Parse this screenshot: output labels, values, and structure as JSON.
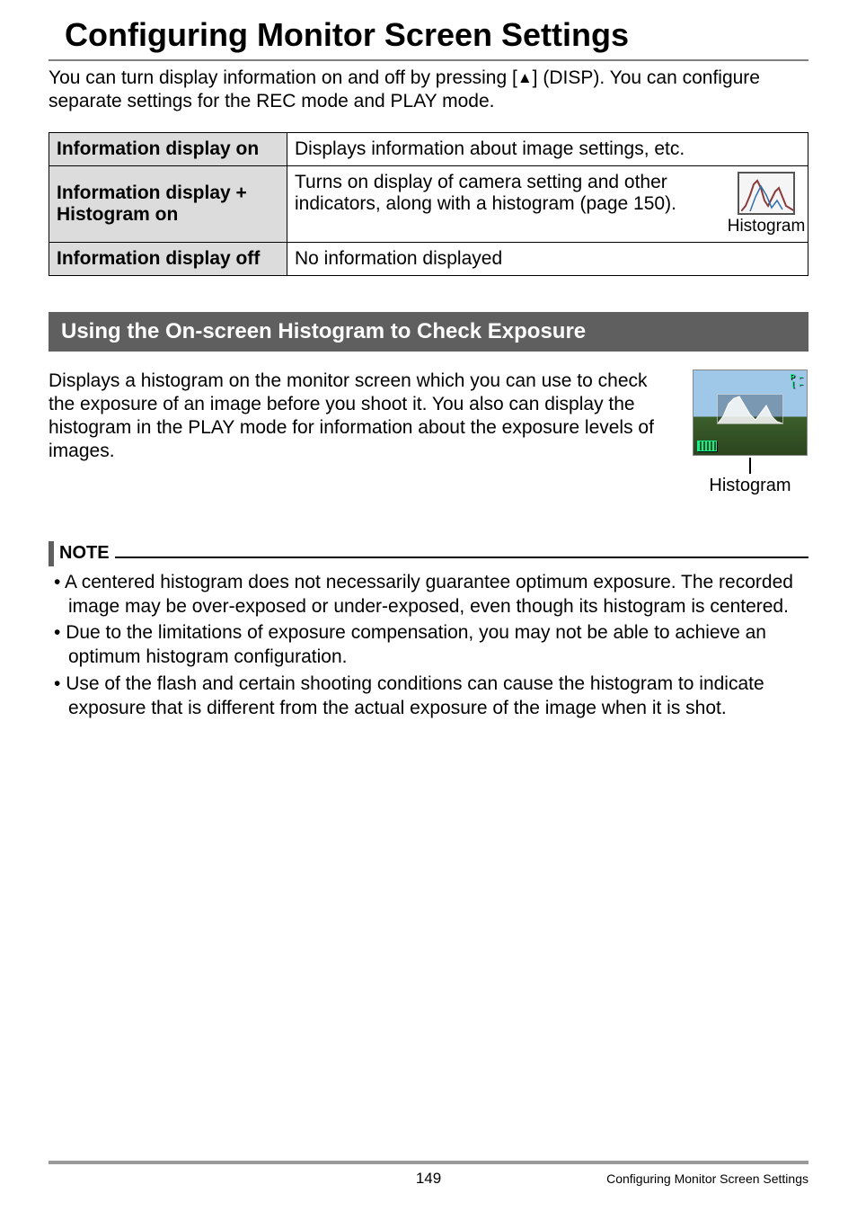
{
  "title": "Configuring Monitor Screen Settings",
  "intro_parts": {
    "before": "You can turn display information on and off by pressing [",
    "after": "] (DISP). You can configure separate settings for the REC mode and PLAY mode."
  },
  "table": {
    "rows": [
      {
        "label": "Information display on",
        "desc": "Displays information about image settings, etc."
      },
      {
        "label": "Information display + Histogram on",
        "desc": "Turns on display of camera setting and other indicators, along with a histogram (page 150).",
        "histogram_caption": "Histogram"
      },
      {
        "label": "Information display off",
        "desc": "No information displayed"
      }
    ]
  },
  "subheader": "Using the On-screen Histogram to Check Exposure",
  "hist_paragraph": "Displays a histogram on the monitor screen which you can use to check the exposure of an image before you shoot it. You also can display the histogram in the PLAY mode for information about the exposure levels of images.",
  "hist_caption": "Histogram",
  "note_label": "NOTE",
  "notes": [
    "A centered histogram does not necessarily guarantee optimum exposure. The recorded image may be over-exposed or under-exposed, even though its histogram is centered.",
    "Due to the limitations of exposure compensation, you may not be able to achieve an optimum histogram configuration.",
    "Use of the flash and certain shooting conditions can cause the histogram to indicate exposure that is different from the actual exposure of the image when it is shot."
  ],
  "footer": {
    "page_number": "149",
    "section": "Configuring Monitor Screen Settings"
  }
}
